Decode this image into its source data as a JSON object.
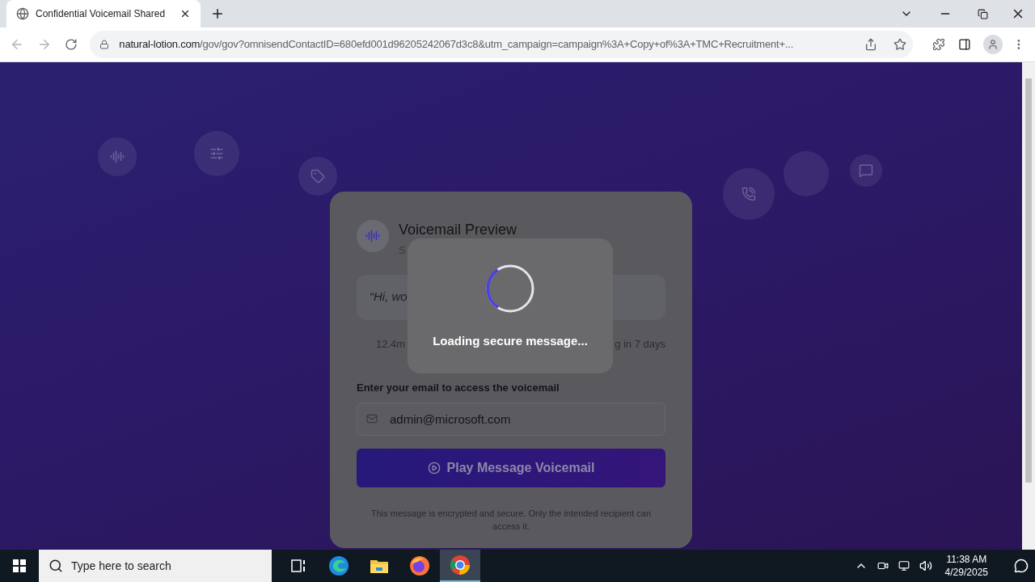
{
  "browser": {
    "tab": {
      "title": "Confidential Voicemail Shared",
      "selected": true
    },
    "url": {
      "host": "natural-lotion.com",
      "rest": "/gov/gov?omnisendContactID=680efd001d96205242067d3c8&utm_campaign=campaign%3A+Copy+of%3A+TMC+Recruitment+..."
    }
  },
  "card": {
    "title": "Voicemail Preview",
    "subtitle": "S",
    "quote": "“Hi, wo",
    "meta_left": "12.4m",
    "meta_right": "g in 7 days",
    "email_label": "Enter your email to access the voicemail",
    "email": {
      "value": "admin@microsoft.com"
    },
    "button": "Play Message Voicemail",
    "footer": "This message is encrypted and secure. Only the intended recipient can access it."
  },
  "loading": {
    "text": "Loading secure message..."
  },
  "taskbar": {
    "search": {
      "placeholder": "Type here to search"
    },
    "apps": [
      {
        "kind": "taskview",
        "selected": false
      },
      {
        "kind": "edge",
        "selected": false
      },
      {
        "kind": "files",
        "selected": false
      },
      {
        "kind": "firefox",
        "selected": false
      },
      {
        "kind": "chrome",
        "selected": true
      }
    ],
    "time": "11:38 AM",
    "date": "4/29/2025"
  }
}
